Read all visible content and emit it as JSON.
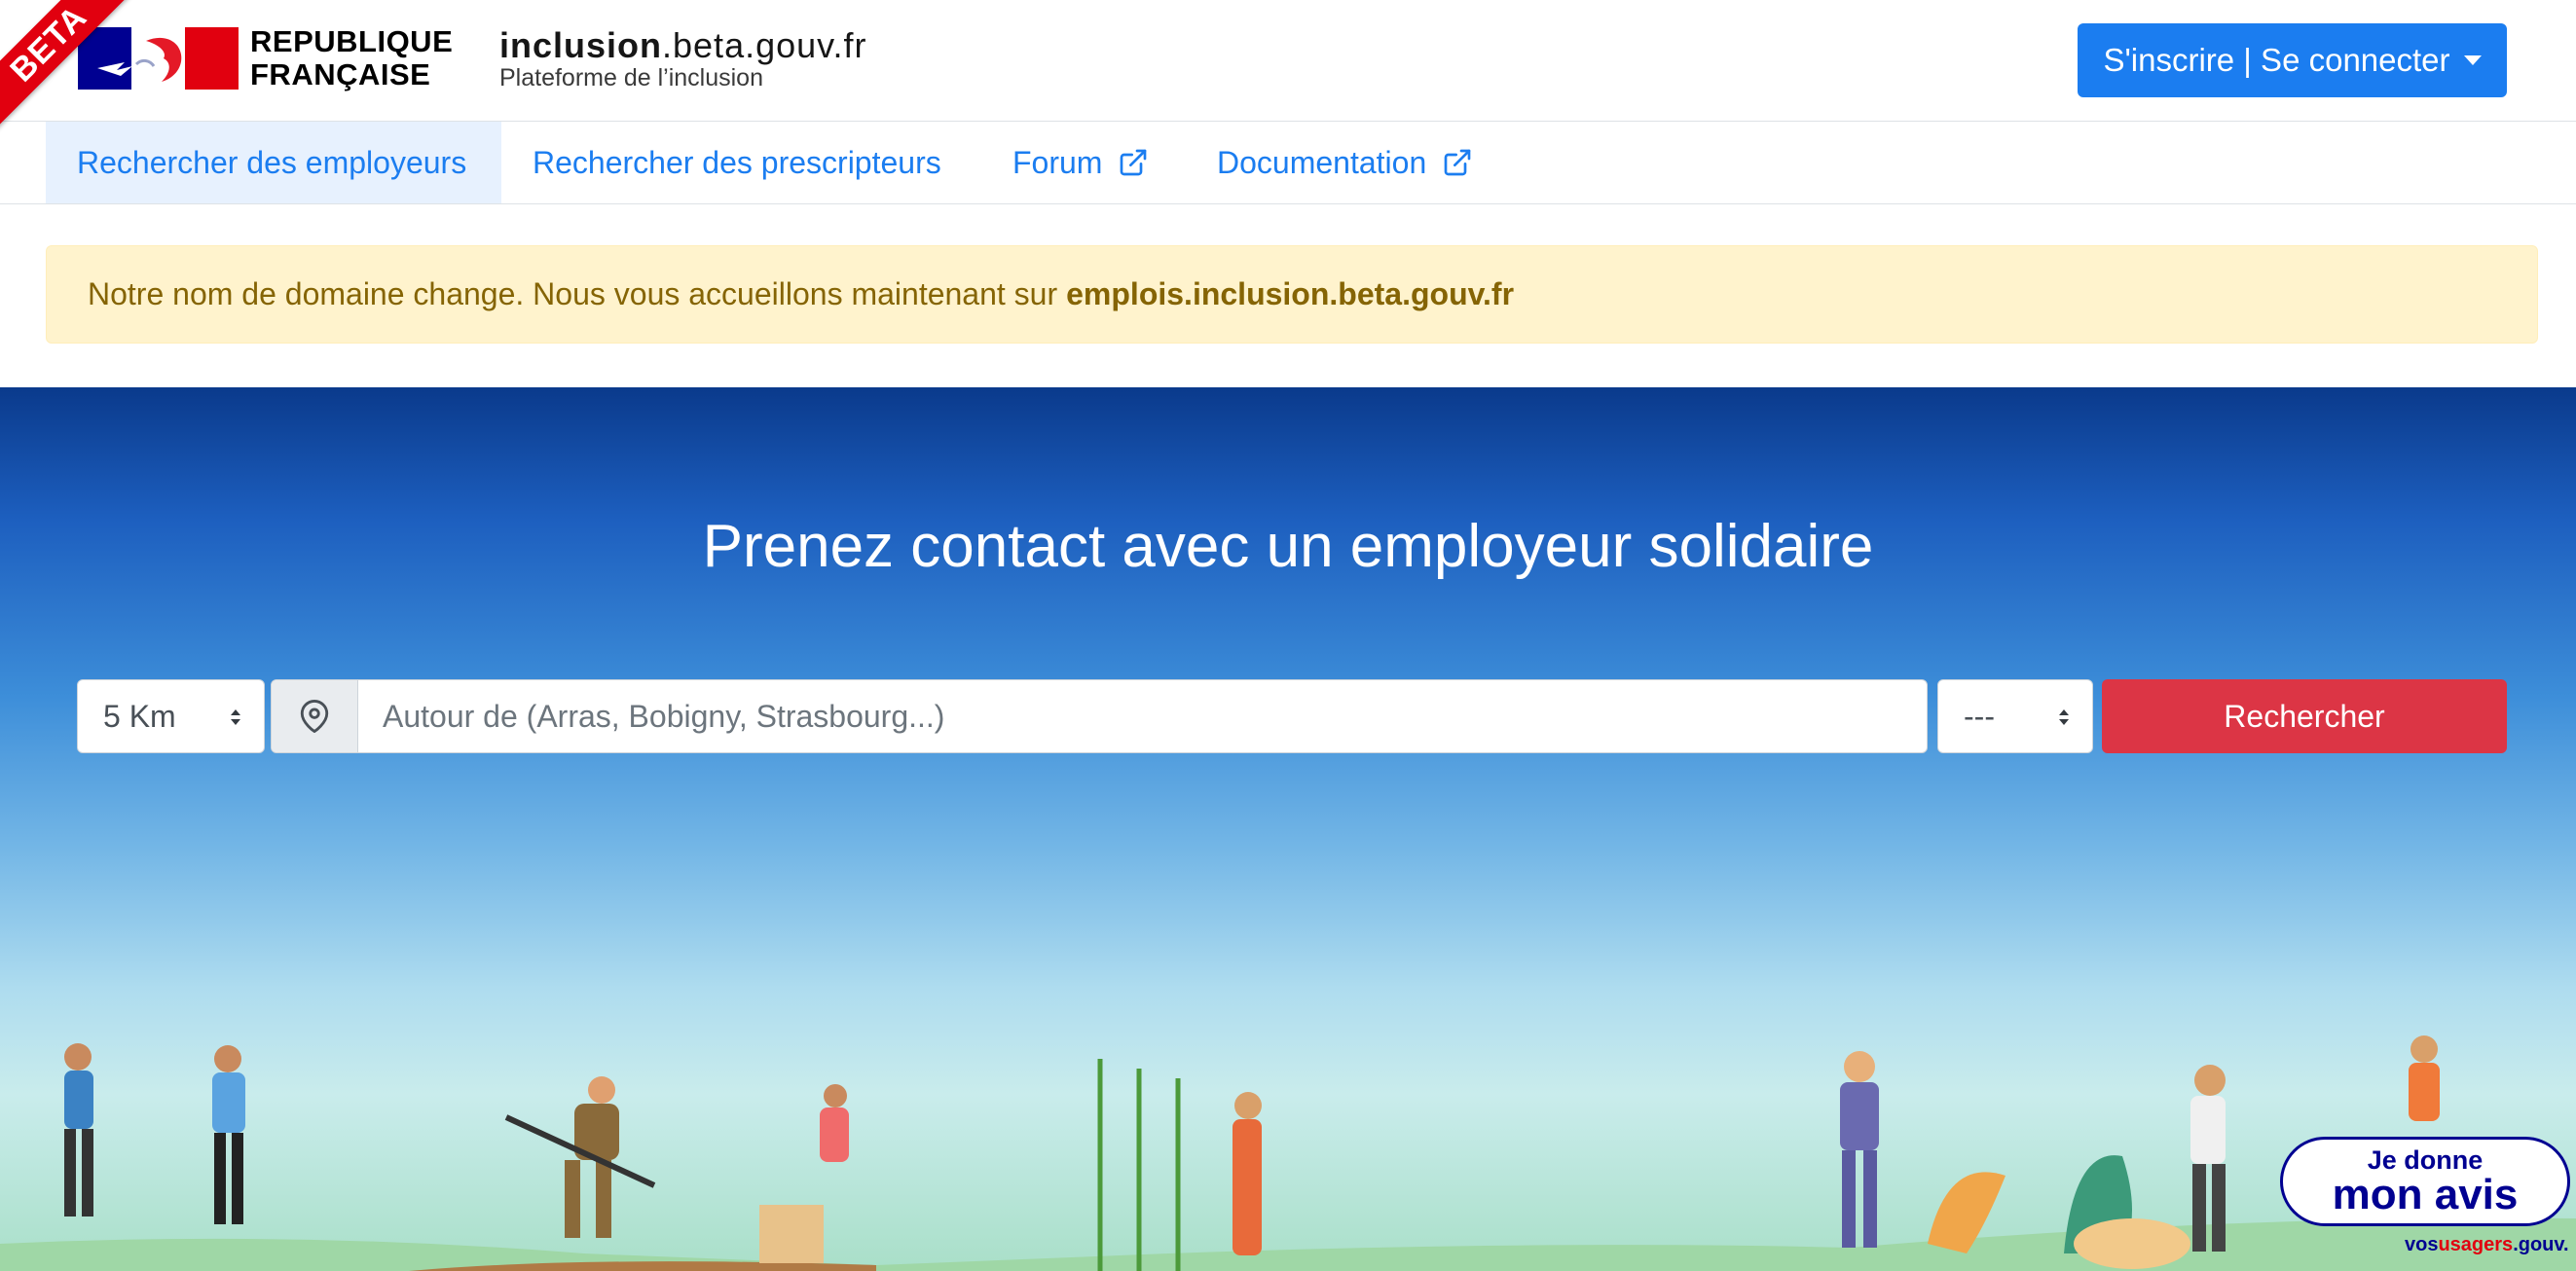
{
  "header": {
    "beta_label": "BETA",
    "republic_line1": "REPUBLIQUE",
    "republic_line2": "FRANÇAISE",
    "site_name_bold": "inclusion",
    "site_name_rest": ".beta.gouv.fr",
    "site_tagline": "Plateforme de l’inclusion",
    "login_label": "S'inscrire | Se connecter"
  },
  "nav": {
    "items": [
      {
        "label": "Rechercher des employeurs",
        "active": true
      },
      {
        "label": "Rechercher des prescripteurs"
      },
      {
        "label": "Forum",
        "icon": "external-link-icon"
      },
      {
        "label": "Documentation",
        "icon": "external-link-icon"
      }
    ]
  },
  "alert": {
    "text": "Notre nom de domaine change. Nous vous accueillons maintenant sur",
    "domain": "emplois.inclusion.beta.gouv.fr"
  },
  "hero": {
    "title": "Prenez contact avec un employeur solidaire"
  },
  "search": {
    "distance_value": "5 Km",
    "location_placeholder": "Autour de (Arras, Bobigny, Strasbourg...)",
    "department_value": "---",
    "submit_label": "Rechercher"
  },
  "feedback": {
    "line1": "Je donne",
    "line2": "mon avis",
    "logo_prefix": "vos",
    "logo_mid": "usagers",
    "logo_suffix": ".gouv."
  },
  "colors": {
    "primary": "#1b7df0",
    "danger": "#dc3545",
    "alert_bg": "#fff3cd",
    "alert_text": "#856404",
    "marianne_blue": "#000091",
    "marianne_red": "#e1000f"
  }
}
